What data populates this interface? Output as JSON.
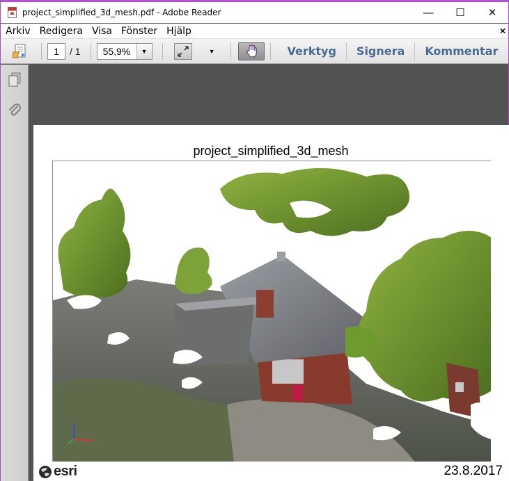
{
  "window": {
    "title": "project_simplified_3d_mesh.pdf - Adobe Reader",
    "controls": {
      "minimize": "—",
      "maximize": "☐",
      "close": "✕"
    }
  },
  "menu": {
    "items": [
      "Arkiv",
      "Redigera",
      "Visa",
      "Fönster",
      "Hjälp"
    ],
    "close": "×"
  },
  "toolbar": {
    "page_current": "1",
    "page_total": "/ 1",
    "zoom": "55,9%",
    "zoom_dropdown": "▼",
    "more_dropdown": "▼",
    "links": [
      "Verktyg",
      "Signera",
      "Kommentar"
    ]
  },
  "document": {
    "map_title": "project_simplified_3d_mesh",
    "logo_text": "esri",
    "date": "23.8.2017"
  },
  "colors": {
    "accent_border": "#b44fd6",
    "toolbar_link": "#4a6b93",
    "workspace": "#535353",
    "foliage": "#6e9a2e",
    "roof": "#7d7f85",
    "brick": "#8a3a2c"
  },
  "icons": {
    "app": "pdf-icon",
    "open": "folder-icon",
    "fit": "expand-icon",
    "hand": "hand-icon",
    "pages": "pages-icon",
    "attachments": "paperclip-icon"
  }
}
